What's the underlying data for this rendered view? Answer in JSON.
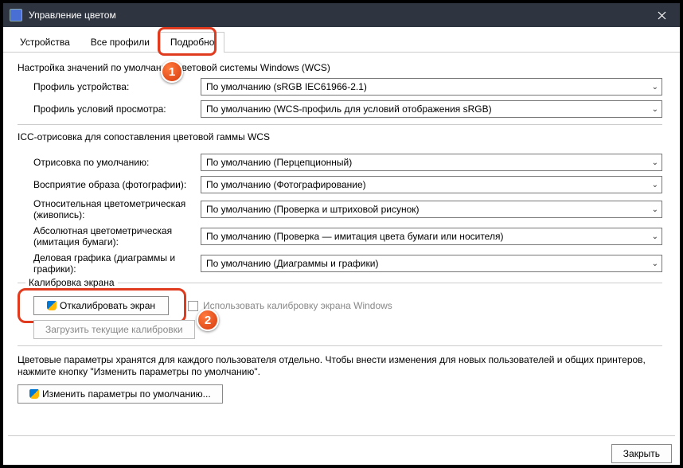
{
  "titlebar": {
    "title": "Управление цветом"
  },
  "tabs": {
    "devices": "Устройства",
    "all_profiles": "Все профили",
    "advanced": "Подробно"
  },
  "wcs": {
    "group_title": "Настройка значений по умолчанию цветовой системы Windows (WCS)",
    "device_profile_label": "Профиль устройства:",
    "device_profile_value": "По умолчанию (sRGB IEC61966-2.1)",
    "viewing_profile_label": "Профиль условий просмотра:",
    "viewing_profile_value": "По умолчанию (WCS-профиль для условий отображения sRGB)"
  },
  "icc": {
    "section_title": "ICC-отрисовка для сопоставления цветовой гаммы WCS",
    "rows": {
      "default_render_label": "Отрисовка по умолчанию:",
      "default_render_value": "По умолчанию (Перцепционный)",
      "perceptual_label": "Восприятие образа (фотографии):",
      "perceptual_value": "По умолчанию (Фотографирование)",
      "rel_color_label": "Относительная цветометрическая (живопись):",
      "rel_color_value": "По умолчанию (Проверка и штриховой рисунок)",
      "abs_color_label": "Абсолютная цветометрическая (имитация бумаги):",
      "abs_color_value": "По умолчанию (Проверка — имитация цвета бумаги или носителя)",
      "business_label": "Деловая графика (диаграммы и графики):",
      "business_value": "По умолчанию (Диаграммы и графики)"
    }
  },
  "calibration": {
    "legend": "Калибровка экрана",
    "calibrate_btn": "Откалибровать экран",
    "use_windows_cal": "Использовать калибровку экрана Windows",
    "reload_btn": "Загрузить текущие калибровки"
  },
  "footer": {
    "info_text": "Цветовые параметры хранятся для каждого пользователя отдельно. Чтобы внести изменения для новых пользователей и общих принтеров, нажмите кнопку \"Изменить параметры по умолчанию\".",
    "change_defaults_btn": "Изменить параметры по умолчанию...",
    "close_btn": "Закрыть"
  },
  "markers": {
    "m1": "1",
    "m2": "2"
  }
}
